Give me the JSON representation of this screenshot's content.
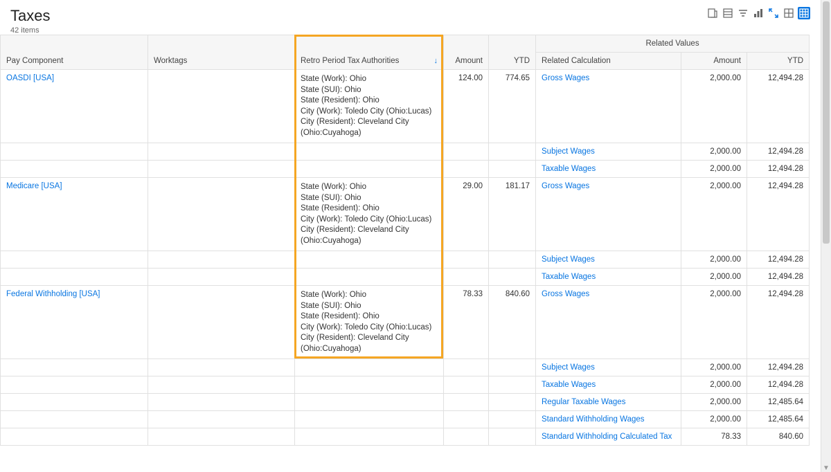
{
  "header": {
    "title": "Taxes",
    "subtitle": "42 items"
  },
  "columns": {
    "pay_component": "Pay Component",
    "worktags": "Worktags",
    "retro": "Retro Period Tax Authorities",
    "amount": "Amount",
    "ytd": "YTD",
    "related_values": "Related Values",
    "related_calc": "Related Calculation",
    "related_amount": "Amount",
    "related_ytd": "YTD"
  },
  "retro_lines": {
    "line1": "State (Work): Ohio",
    "line2": "State (SUI): Ohio",
    "line3": "State (Resident): Ohio",
    "line4": "City (Work): Toledo City (Ohio:Lucas)",
    "line5": "City (Resident): Cleveland City (Ohio:Cuyahoga)"
  },
  "rows": [
    {
      "pay": "OASDI [USA]",
      "amount": "124.00",
      "ytd": "774.65",
      "rel": "Gross Wages",
      "rel_amount": "2,000.00",
      "rel_ytd": "12,494.28",
      "retro": true
    },
    {
      "pay": "",
      "amount": "",
      "ytd": "",
      "rel": "Subject Wages",
      "rel_amount": "2,000.00",
      "rel_ytd": "12,494.28",
      "retro": false
    },
    {
      "pay": "",
      "amount": "",
      "ytd": "",
      "rel": "Taxable Wages",
      "rel_amount": "2,000.00",
      "rel_ytd": "12,494.28",
      "retro": false
    },
    {
      "pay": "Medicare [USA]",
      "amount": "29.00",
      "ytd": "181.17",
      "rel": "Gross Wages",
      "rel_amount": "2,000.00",
      "rel_ytd": "12,494.28",
      "retro": true
    },
    {
      "pay": "",
      "amount": "",
      "ytd": "",
      "rel": "Subject Wages",
      "rel_amount": "2,000.00",
      "rel_ytd": "12,494.28",
      "retro": false
    },
    {
      "pay": "",
      "amount": "",
      "ytd": "",
      "rel": "Taxable Wages",
      "rel_amount": "2,000.00",
      "rel_ytd": "12,494.28",
      "retro": false
    },
    {
      "pay": "Federal Withholding [USA]",
      "amount": "78.33",
      "ytd": "840.60",
      "rel": "Gross Wages",
      "rel_amount": "2,000.00",
      "rel_ytd": "12,494.28",
      "retro": true
    },
    {
      "pay": "",
      "amount": "",
      "ytd": "",
      "rel": "Subject Wages",
      "rel_amount": "2,000.00",
      "rel_ytd": "12,494.28",
      "retro": false
    },
    {
      "pay": "",
      "amount": "",
      "ytd": "",
      "rel": "Taxable Wages",
      "rel_amount": "2,000.00",
      "rel_ytd": "12,494.28",
      "retro": false
    },
    {
      "pay": "",
      "amount": "",
      "ytd": "",
      "rel": "Regular Taxable Wages",
      "rel_amount": "2,000.00",
      "rel_ytd": "12,485.64",
      "retro": false
    },
    {
      "pay": "",
      "amount": "",
      "ytd": "",
      "rel": "Standard Withholding Wages",
      "rel_amount": "2,000.00",
      "rel_ytd": "12,485.64",
      "retro": false
    },
    {
      "pay": "",
      "amount": "",
      "ytd": "",
      "rel": "Standard Withholding Calculated Tax",
      "rel_amount": "78.33",
      "rel_ytd": "840.60",
      "retro": false
    }
  ]
}
